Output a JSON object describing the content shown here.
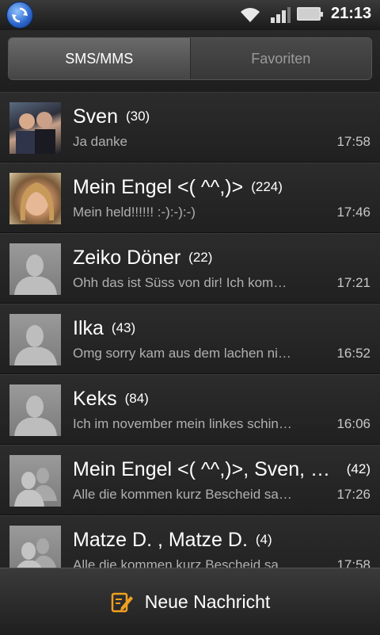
{
  "status_bar": {
    "time": "21:13",
    "icons": [
      "sync-icon",
      "wifi-icon",
      "signal-icon",
      "battery-icon"
    ]
  },
  "tabs": [
    {
      "label": "SMS/MMS",
      "active": true
    },
    {
      "label": "Favoriten",
      "active": false
    }
  ],
  "conversations": [
    {
      "name": "Sven",
      "count": "(30)",
      "preview": "Ja danke",
      "time": "17:58",
      "avatar": "photo"
    },
    {
      "name": "Mein Engel <( ^^,)>",
      "count": "(224)",
      "preview": "Mein held!!!!!! :-):-):-)",
      "time": "17:46",
      "avatar": "photo"
    },
    {
      "name": "Zeiko Döner",
      "count": "(22)",
      "preview": "Ohh das ist Süss von dir! Ich kom…",
      "time": "17:21",
      "avatar": "person-icon"
    },
    {
      "name": "Ilka",
      "count": "(43)",
      "preview": "Omg sorry kam aus dem lachen ni…",
      "time": "16:52",
      "avatar": "person-icon"
    },
    {
      "name": "Keks",
      "count": "(84)",
      "preview": "Ich im november mein linkes schin…",
      "time": "16:06",
      "avatar": "person-icon"
    },
    {
      "name": "Mein Engel <( ^^,)>, Sven, …",
      "count": "(42)",
      "preview": "Alle die kommen kurz Bescheid sa…",
      "time": "17:26",
      "avatar": "group-icon"
    },
    {
      "name": "Matze D. , Matze D.",
      "count": "(4)",
      "preview": "Alle die kommen kurz Bescheid sa…",
      "time": "17:58",
      "avatar": "group-icon"
    }
  ],
  "bottom_bar": {
    "compose_label": "Neue Nachricht",
    "icon": "compose-icon"
  }
}
